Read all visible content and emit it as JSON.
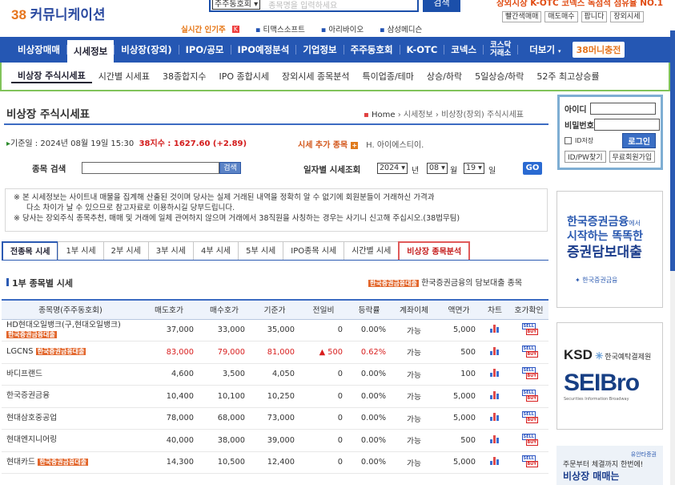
{
  "header": {
    "logo_num": "38",
    "logo_text": "커뮤니케이션",
    "search_select": "주주동호회",
    "search_placeholder": "종목명을 입력하세요",
    "search_button": "검색",
    "tagline": "장외시장 K-OTC 코넥스 독점적 점유율 NO.1",
    "top_links": [
      "빨간색매매",
      "매도매수",
      "팝니다",
      "장외시세"
    ],
    "ticker_label": "실시간 인기주",
    "ticker_hot": "K",
    "ticker_items": [
      "티맥스소프트",
      "아리바이오",
      "삼성메디슨"
    ]
  },
  "main_nav": {
    "items": [
      "비상장매매",
      "시세정보",
      "비상장(장외)",
      "IPO/공모",
      "IPO예정분석",
      "기업정보",
      "주주동호회",
      "K-OTC",
      "코넥스"
    ],
    "kosdaq_line1": "코스닥",
    "kosdaq_line2": "거래소",
    "more": "더보기",
    "charge": "38머니충전"
  },
  "sub_nav": {
    "items": [
      "비상장 주식시세표",
      "시간별 시세표",
      "38종합지수",
      "IPO 종합시세",
      "장외시세 종목분석",
      "특이업종/테마",
      "상승/하락",
      "5일상승/하락",
      "52주 최고상승률"
    ]
  },
  "page": {
    "title": "비상장 주식시세표",
    "crumb_home": "Home",
    "crumb_rest": "› 시세정보 › 비상장(장외) 주식시세표",
    "date_prefix": "기준일 : 2024년 08월 19일 15:30",
    "index_text": "38지수 : 1627.60 (+2.89)",
    "add_label": "시세 추가 종목",
    "add_plus": "+",
    "add_name": "H. 아이에스티이.",
    "search_label": "종목 검색",
    "search_button": "검색",
    "date_label": "일자별 시세조회",
    "year": "2024",
    "year_unit": "년",
    "month": "08",
    "month_unit": "월",
    "day": "19",
    "day_unit": "일",
    "go": "GO",
    "notice1": "※ 본 시세정보는 사이트내 매물을 집계해 산출된 것이며 당사는 실제 거래된 내역을 정확히 알 수 없기에 회원분들이 거래하신 가격과",
    "notice2": "다소 차이가 날 수 있으므로 참고자료로 이용하시길 당부드립니다.",
    "notice3": "※ 당사는 장외주식 종목추천, 매매 및 거래에 일체 관여하지 않으며 거래에서 38직원을 사칭하는 경우는 사기니 신고해 주십시오.(38법무팀)",
    "section_title": "1부 종목별 시세",
    "loan_badge": "한국증권금융대출",
    "loan_text": "한국증권금융의 담보대출 종목"
  },
  "tabs": [
    "전종목 시세",
    "1부 시세",
    "2부 시세",
    "3부 시세",
    "4부 시세",
    "5부 시세",
    "IPO종목 시세",
    "시간별 시세",
    "비상장 종목분석"
  ],
  "table": {
    "headers": [
      "종목명(주주동호회)",
      "매도호가",
      "매수호가",
      "기준가",
      "전일비",
      "등락률",
      "계좌이체",
      "액면가",
      "차트",
      "호가확인"
    ],
    "rows": [
      {
        "name": "HD현대오일뱅크(구,현대오일뱅크)",
        "badge": "한국증권금융대출",
        "sell": "37,000",
        "buy": "33,000",
        "base": "35,000",
        "diff": "0",
        "rate": "0.00%",
        "transfer": "가능",
        "face": "5,000",
        "up": false
      },
      {
        "name": "LGCNS",
        "badge": "한국증권금융대출",
        "sell": "83,000",
        "buy": "79,000",
        "base": "81,000",
        "diff": "▲ 500",
        "rate": "0.62%",
        "transfer": "가능",
        "face": "500",
        "up": true
      },
      {
        "name": "바디프랜드",
        "badge": "",
        "sell": "4,600",
        "buy": "3,500",
        "base": "4,050",
        "diff": "0",
        "rate": "0.00%",
        "transfer": "가능",
        "face": "100",
        "up": false
      },
      {
        "name": "한국증권금융",
        "badge": "",
        "sell": "10,400",
        "buy": "10,100",
        "base": "10,250",
        "diff": "0",
        "rate": "0.00%",
        "transfer": "가능",
        "face": "5,000",
        "up": false
      },
      {
        "name": "현대삼호중공업",
        "badge": "",
        "sell": "78,000",
        "buy": "68,000",
        "base": "73,000",
        "diff": "0",
        "rate": "0.00%",
        "transfer": "가능",
        "face": "5,000",
        "up": false
      },
      {
        "name": "현대엔지니어링",
        "badge": "",
        "sell": "40,000",
        "buy": "38,000",
        "base": "39,000",
        "diff": "0",
        "rate": "0.00%",
        "transfer": "가능",
        "face": "500",
        "up": false
      },
      {
        "name": "현대카드",
        "badge": "한국증권금융대출",
        "sell": "14,300",
        "buy": "10,500",
        "base": "12,400",
        "diff": "0",
        "rate": "0.00%",
        "transfer": "가능",
        "face": "5,000",
        "up": false
      }
    ],
    "sell_icon_text": "SELL",
    "buy_icon_text": "BUY"
  },
  "login": {
    "id_label": "아이디",
    "pw_label": "비밀번호",
    "save_label": "ID저장",
    "login_button": "로그인",
    "find_link": "ID/PW찾기",
    "join_link": "무료회원가입"
  },
  "ads": {
    "ad1_l1": "한국증권금융",
    "ad1_small": "에서",
    "ad1_l2": "시작하는 똑똑한",
    "ad1_l3": "증권담보대출",
    "ad1_brand": "한국증권금융",
    "ad2_ksd": "KSD",
    "ad2_ksd_sub": "한국예탁결제원",
    "ad2_sei": "SEIBro",
    "ad2_sub": "Securities Information Broadway",
    "ad3_brand": "유안타증권",
    "ad3_l1": "주문부터 체결까지 한번에!",
    "ad3_l2": "비상장 매매는"
  },
  "colors": {
    "brand_blue": "#2557b3",
    "accent_orange": "#e6751d",
    "up_red": "#d81e1e",
    "subnav_green": "#81c35a"
  }
}
